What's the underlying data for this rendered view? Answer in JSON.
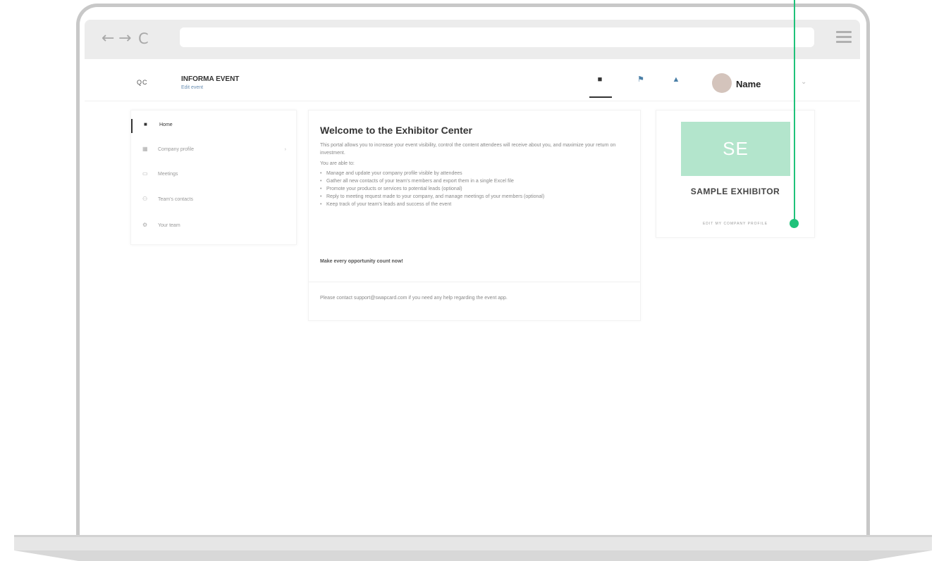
{
  "browser": {
    "back_icon": "←",
    "forward_icon": "→",
    "reload_icon": "C",
    "url": ""
  },
  "header": {
    "logo": "QC",
    "event_title": "INFORMA EVENT",
    "event_subtitle": "Edit event",
    "user_name": "Name"
  },
  "sidebar": {
    "items": [
      {
        "label": "Home",
        "icon": "home-icon",
        "glyph": "■",
        "active": true
      },
      {
        "label": "Company profile",
        "icon": "grid-icon",
        "glyph": "▦",
        "chevron": "›"
      },
      {
        "label": "Meetings",
        "icon": "chat-icon",
        "glyph": "▭"
      },
      {
        "label": "Team's contacts",
        "icon": "contacts-icon",
        "glyph": "⚇"
      },
      {
        "label": "Your team",
        "icon": "gear-icon",
        "glyph": "⚙"
      }
    ]
  },
  "main": {
    "title": "Welcome to the Exhibitor Center",
    "intro": "This portal allows you to increase your event visibility, control the content attendees will receive about you, and maximize your return on investment.",
    "able_to": "You are able to:",
    "bullets": [
      "Manage and update your company profile visible by attendees",
      "Gather all new contacts of your team's members and export them in a single Excel file",
      "Promote your products or services to potential leads (optional)",
      "Reply to meeting request made to your company, and manage meetings of your members (optional)",
      "Keep track of your team's leads and success of the event"
    ],
    "cta": "Make every opportunity count now!",
    "support": "Please contact support@swapcard.com if you need any help regarding the event app."
  },
  "profile": {
    "initials": "SE",
    "name": "SAMPLE EXHIBITOR",
    "edit_link": "EDIT MY COMPANY PROFILE"
  },
  "colors": {
    "accent_green": "#1fc27a",
    "tile_green": "#b3e5cc",
    "icon_blue": "#4a7fa7"
  }
}
